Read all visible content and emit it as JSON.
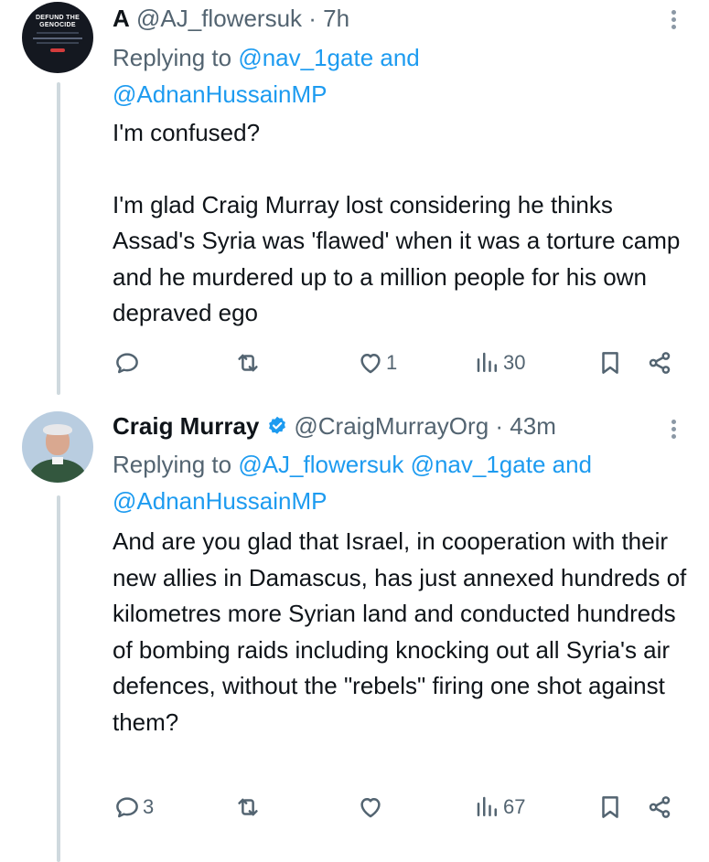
{
  "tweets": [
    {
      "display_name": "A",
      "handle": "@AJ_flowersuk",
      "time": "· 7h",
      "verified": false,
      "avatar": {
        "title_line1": "DEFUND THE",
        "title_line2": "GENOCIDE"
      },
      "replying_to": {
        "prefix": "Replying to",
        "mentions": [
          "@nav_1gate"
        ],
        "joiner": "and",
        "last_mention": "@AdnanHussainMP"
      },
      "body": [
        "I'm confused?",
        "I'm glad Craig Murray lost considering he thinks Assad's Syria was 'flawed' when it was a torture camp and he murdered up to a million people for his own depraved  ego"
      ],
      "actions": {
        "replies": "",
        "retweets": "",
        "likes": "1",
        "views": "30"
      }
    },
    {
      "display_name": "Craig Murray",
      "handle": "@CraigMurrayOrg",
      "time": "· 43m",
      "verified": true,
      "replying_to": {
        "prefix": "Replying to",
        "mentions": [
          "@AJ_flowersuk",
          "@nav_1gate"
        ],
        "joiner": "and",
        "last_mention": "@AdnanHussainMP"
      },
      "body": [
        "And are you glad that Israel, in cooperation with their new allies in Damascus, has just annexed hundreds of kilometres more Syrian land and conducted hundreds of bombing raids including knocking out all Syria's air defences, without the \"rebels\" firing one shot against them?"
      ],
      "actions": {
        "replies": "3",
        "retweets": "",
        "likes": "",
        "views": "67"
      }
    }
  ],
  "icons": {
    "reply": "reply-icon",
    "retweet": "retweet-icon",
    "like": "heart-icon",
    "views": "views-icon",
    "bookmark": "bookmark-icon",
    "share": "share-icon",
    "more": "more-icon",
    "verified": "verified-badge-icon"
  },
  "colors": {
    "text": "#0f1419",
    "secondary": "#536471",
    "link": "#1d9bf0",
    "thread_line": "#cfd9de",
    "verified": "#1d9bf0"
  }
}
